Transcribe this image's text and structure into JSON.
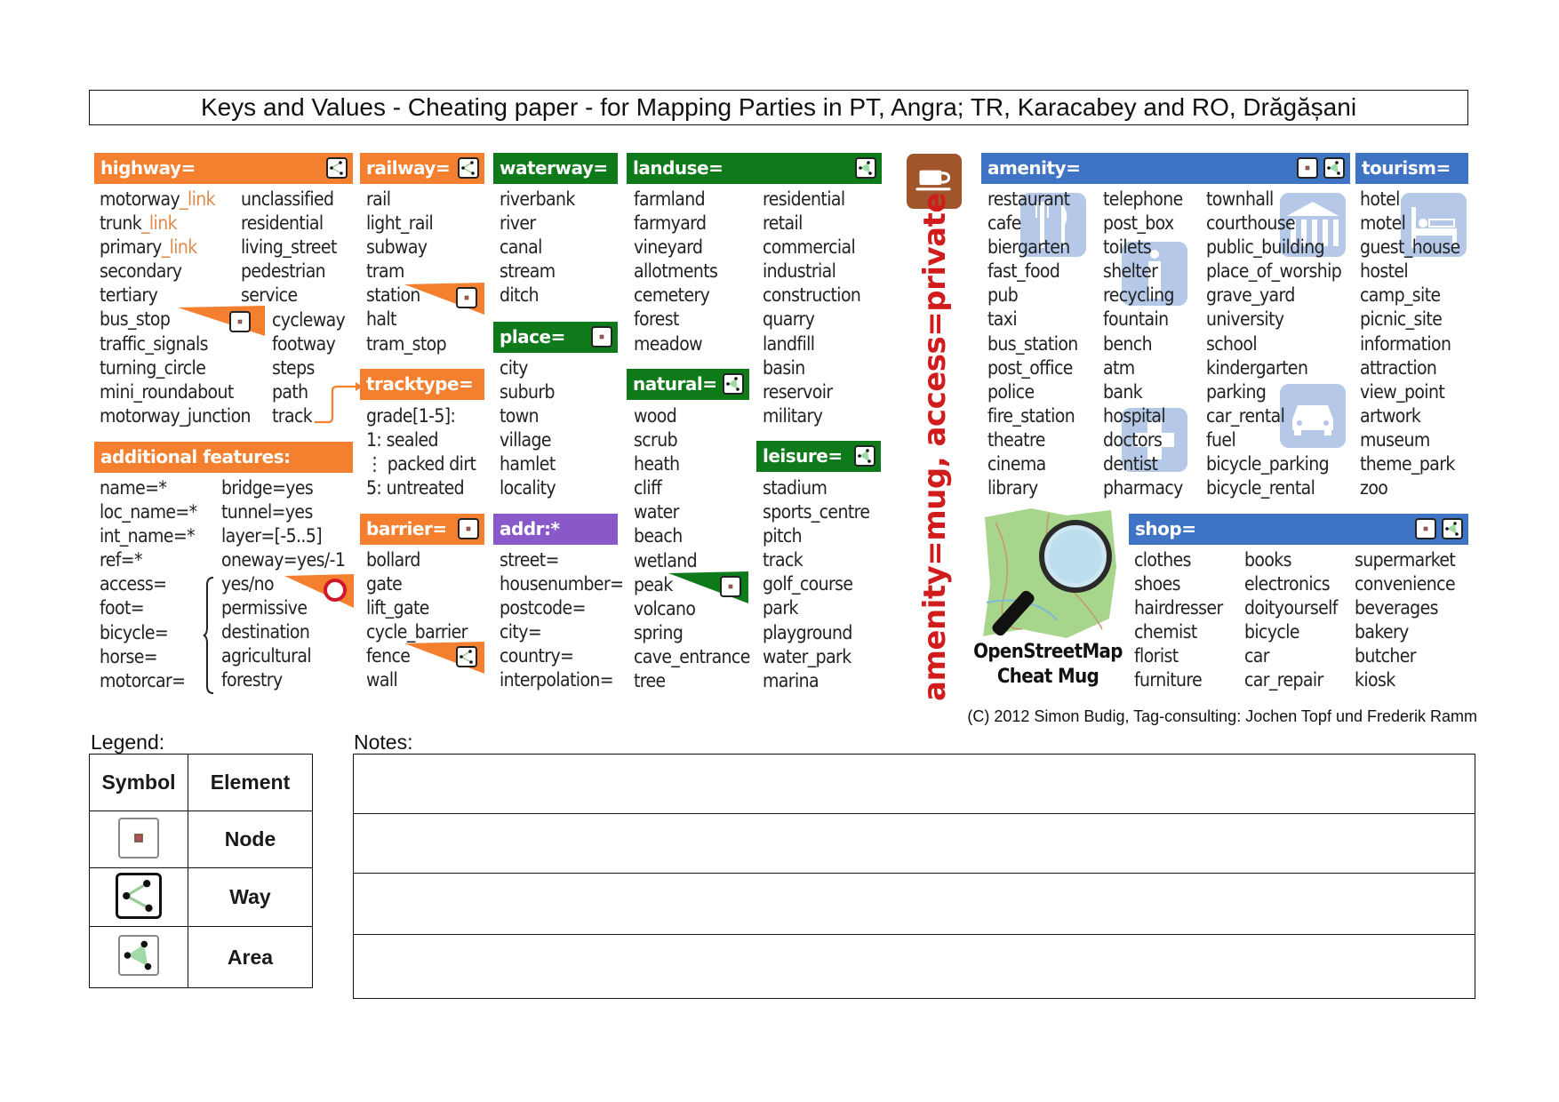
{
  "title": "Keys and Values - Cheating paper - for Mapping Parties in PT, Angra; TR, Karacabey and RO, Drăgășani",
  "colors": {
    "orange": "#f47f2f",
    "green": "#0f7a1a",
    "purple": "#8a59c9",
    "blue": "#3f74c4",
    "mug_text": "#d01c1c",
    "mug_icon": "#a0552a",
    "link_text": "#e08a4a"
  },
  "sections": {
    "highway": {
      "header": "highway=",
      "symbol": "way-icon",
      "col1": [
        "motorway",
        "trunk",
        "primary",
        "secondary",
        "tertiary",
        "bus_stop",
        "traffic_signals",
        "turning_circle",
        "mini_roundabout",
        "motorway_junction"
      ],
      "col1_suffix": [
        "_link",
        "_link",
        "_link"
      ],
      "col2": [
        "unclassified",
        "residential",
        "living_street",
        "pedestrian",
        "service"
      ],
      "col3": [
        "cycleway",
        "footway",
        "steps",
        "path",
        "track"
      ]
    },
    "additional": {
      "header": "additional features:",
      "col1": [
        "name=*",
        "loc_name=*",
        "int_name=*",
        "ref=*",
        "access=",
        "foot=",
        "bicycle=",
        "horse=",
        "motorcar="
      ],
      "col2": [
        "bridge=yes",
        "tunnel=yes",
        "layer=[-5..5]",
        "oneway=yes/-1"
      ],
      "access_values": [
        "yes/no",
        "permissive",
        "destination",
        "agricultural",
        "forestry"
      ]
    },
    "railway": {
      "header": "railway=",
      "symbol": "way-icon",
      "items": [
        "rail",
        "light_rail",
        "subway",
        "tram",
        "station",
        "halt",
        "tram_stop"
      ]
    },
    "tracktype": {
      "header": "tracktype=",
      "items": [
        "grade[1-5]:",
        "1: sealed",
        "⋮  packed dirt",
        "5: untreated"
      ]
    },
    "barrier": {
      "header": "barrier=",
      "symbol": "node-icon",
      "items": [
        "bollard",
        "gate",
        "lift_gate",
        "cycle_barrier",
        "fence",
        "wall"
      ]
    },
    "waterway": {
      "header": "waterway=",
      "items": [
        "riverbank",
        "river",
        "canal",
        "stream",
        "ditch"
      ]
    },
    "place": {
      "header": "place=",
      "symbol": "node-icon",
      "items": [
        "city",
        "suburb",
        "town",
        "village",
        "hamlet",
        "locality"
      ]
    },
    "addr": {
      "header": "addr:*",
      "items": [
        "street=",
        "housenumber=",
        "postcode=",
        "city=",
        "country=",
        "interpolation="
      ]
    },
    "landuse": {
      "header": "landuse=",
      "symbol": "area-icon",
      "col1": [
        "farmland",
        "farmyard",
        "vineyard",
        "allotments",
        "cemetery",
        "forest",
        "meadow"
      ],
      "col2": [
        "residential",
        "retail",
        "commercial",
        "industrial",
        "construction",
        "quarry",
        "landfill",
        "basin",
        "reservoir",
        "military"
      ]
    },
    "natural": {
      "header": "natural=",
      "symbol": "area-icon",
      "items": [
        "wood",
        "scrub",
        "heath",
        "cliff",
        "water",
        "beach",
        "wetland",
        "peak",
        "volcano",
        "spring",
        "cave_entrance",
        "tree"
      ]
    },
    "leisure": {
      "header": "leisure=",
      "symbol": "area-icon",
      "items": [
        "stadium",
        "sports_centre",
        "pitch",
        "track",
        "golf_course",
        "park",
        "playground",
        "water_park",
        "marina"
      ]
    },
    "mug": {
      "text": "amenity=mug, access=private",
      "logo_title_1": "OpenStreetMap",
      "logo_title_2": "Cheat Mug"
    },
    "amenity": {
      "header": "amenity=",
      "col1": [
        "restaurant",
        "cafe",
        "biergarten",
        "fast_food",
        "pub",
        "taxi",
        "bus_station",
        "post_office",
        "police",
        "fire_station",
        "theatre",
        "cinema",
        "library"
      ],
      "col2": [
        "telephone",
        "post_box",
        "toilets",
        "shelter",
        "recycling",
        "fountain",
        "bench",
        "atm",
        "bank",
        "hospital",
        "doctors",
        "dentist",
        "pharmacy"
      ],
      "col3": [
        "townhall",
        "courthouse",
        "public_building",
        "place_of_worship",
        "grave_yard",
        "university",
        "school",
        "kindergarten",
        "parking",
        "car_rental",
        "fuel",
        "bicycle_parking",
        "bicycle_rental"
      ]
    },
    "tourism": {
      "header": "tourism=",
      "items": [
        "hotel",
        "motel",
        "guest_house",
        "hostel",
        "camp_site",
        "picnic_site",
        "information",
        "attraction",
        "view_point",
        "artwork",
        "museum",
        "theme_park",
        "zoo"
      ]
    },
    "shop": {
      "header": "shop=",
      "col1": [
        "clothes",
        "shoes",
        "hairdresser",
        "chemist",
        "florist",
        "furniture"
      ],
      "col2": [
        "books",
        "electronics",
        "doityourself",
        "bicycle",
        "car",
        "car_repair"
      ],
      "col3": [
        "supermarket",
        "convenience",
        "beverages",
        "bakery",
        "butcher",
        "kiosk"
      ]
    }
  },
  "copyright": "(C) 2012 Simon Budig, Tag-consulting: Jochen Topf und Frederik Ramm",
  "legend": {
    "label": "Legend:",
    "header_symbol": "Symbol",
    "header_element": "Element",
    "rows": [
      {
        "icon": "node-icon",
        "element": "Node"
      },
      {
        "icon": "way-icon",
        "element": "Way"
      },
      {
        "icon": "area-icon",
        "element": "Area"
      }
    ]
  },
  "notes": {
    "label": "Notes:",
    "rows": 4
  }
}
